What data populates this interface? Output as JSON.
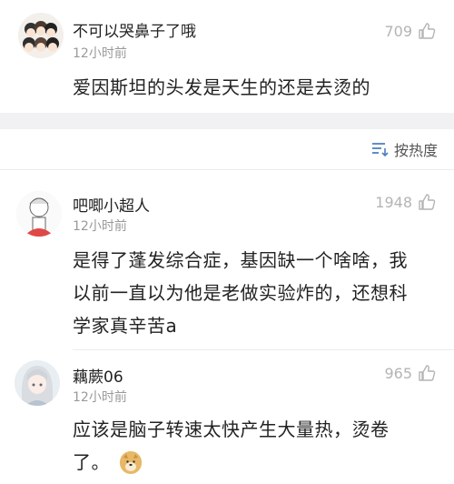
{
  "top_comment": {
    "username": "不可以哭鼻子了哦",
    "time": "12小时前",
    "likes": "709",
    "text": "爱因斯坦的头发是天生的还是去烫的"
  },
  "sort": {
    "label": "按热度"
  },
  "replies": [
    {
      "username": "吧唧小超人",
      "time": "12小时前",
      "likes": "1948",
      "lines": [
        "是得了蓬发综合症，基因缺一个啥啥，我",
        "以前一直以为他是老做实验炸的，还想科",
        "学家真辛苦a"
      ]
    },
    {
      "username": "藕蕨06",
      "time": "12小时前",
      "likes": "965",
      "lines": [
        "应该是脑子转速太快产生大量热，烫卷",
        "了。"
      ],
      "emoji": "doge"
    }
  ]
}
